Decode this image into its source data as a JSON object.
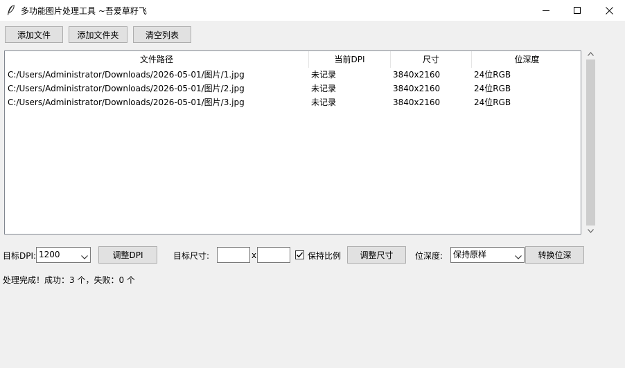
{
  "window": {
    "title": "多功能图片处理工具 ~吾爱草籽飞"
  },
  "toolbar": {
    "add_file": "添加文件",
    "add_folder": "添加文件夹",
    "clear_list": "清空列表"
  },
  "table": {
    "columns": [
      "文件路径",
      "当前DPI",
      "尺寸",
      "位深度"
    ],
    "rows": [
      [
        "C:/Users/Administrator/Downloads/2026-05-01/图片/1.jpg",
        "未记录",
        "3840x2160",
        "24位RGB"
      ],
      [
        "C:/Users/Administrator/Downloads/2026-05-01/图片/2.jpg",
        "未记录",
        "3840x2160",
        "24位RGB"
      ],
      [
        "C:/Users/Administrator/Downloads/2026-05-01/图片/3.jpg",
        "未记录",
        "3840x2160",
        "24位RGB"
      ]
    ]
  },
  "controls": {
    "target_dpi_label": "目标DPI:",
    "target_dpi_value": "1200",
    "adjust_dpi": "调整DPI",
    "target_size_label": "目标尺寸:",
    "width_value": "",
    "size_separator": "x",
    "height_value": "",
    "keep_ratio_label": "保持比例",
    "keep_ratio_checked": true,
    "adjust_size": "调整尺寸",
    "bit_depth_label": "位深度:",
    "bit_depth_value": "保持原样",
    "convert_depth": "转换位深"
  },
  "status": {
    "text": "处理完成！成功：3 个，失败：0 个"
  }
}
